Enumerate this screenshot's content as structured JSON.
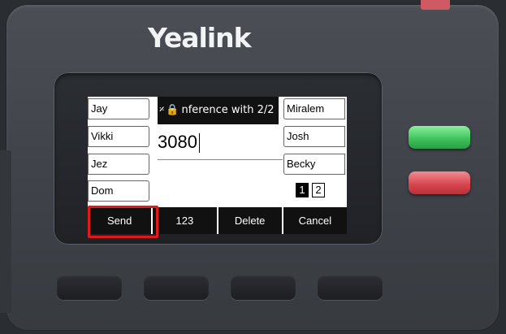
{
  "brand": "Yealink",
  "status": {
    "icon_headset": "headset-icon",
    "icon_lock": "lock-icon",
    "title": "nference with  2/2"
  },
  "line_keys": {
    "left": [
      "Jay",
      "Vikki",
      "Jez",
      "Dom"
    ],
    "right": [
      "Miralem",
      "Josh",
      "Becky"
    ]
  },
  "entry": {
    "value": "3080"
  },
  "page_indicator": {
    "pages": [
      "1",
      "2"
    ],
    "active_index": 0
  },
  "softkeys": [
    "Send",
    "123",
    "Delete",
    "Cancel"
  ],
  "highlighted_softkey": "Send",
  "colors": {
    "highlight": "#e01a1a",
    "answer": "#3bbf5a",
    "hangup": "#d6434d",
    "indicator": "#cf5a63"
  }
}
